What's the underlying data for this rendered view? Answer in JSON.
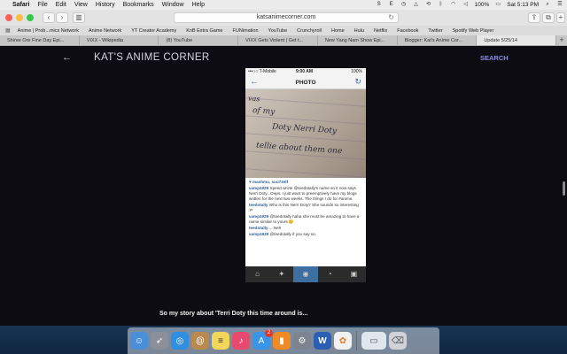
{
  "menubar": {
    "items": [
      "Safari",
      "File",
      "Edit",
      "View",
      "History",
      "Bookmarks",
      "Window",
      "Help"
    ],
    "battery": "100%",
    "clock": "Sat 5:13 PM"
  },
  "toolbar": {
    "url": "katsanimecorner.com"
  },
  "favorites": [
    "Anime | Prob...mics Network",
    "Anime Network",
    "YT Creator Academy",
    "KnB Extra Game",
    "FUNimation",
    "YouTube",
    "Crunchyroll",
    "Home",
    "Hulu",
    "Netflix",
    "Facebook",
    "Twitter",
    "Spotify Web Player"
  ],
  "tabs": [
    {
      "label": "Shiree Ore Fine Day Epi...",
      "active": false
    },
    {
      "label": "VIXX - Wikipedia",
      "active": false
    },
    {
      "label": "(8) YouTube",
      "active": false
    },
    {
      "label": "VIXX Gets Violent | Get t...",
      "active": false
    },
    {
      "label": "New Yang Nam Show Epi...",
      "active": false
    },
    {
      "label": "Blogger: Kat's Anime Cor...",
      "active": false
    },
    {
      "label": "Update 5/25/14",
      "active": true
    }
  ],
  "page": {
    "back_label": "←",
    "site_title": "KAT'S ANIME CORNER",
    "search_label": "SEARCH",
    "caption": "So my story about 'Terri Doty this time around is..."
  },
  "phone": {
    "carrier": "•••○○ T-Mobile",
    "time": "9:00 AM",
    "battery": "100%",
    "title": "PHOTO",
    "handwriting": [
      "vas",
      "of my",
      "Doty Nerri Doty",
      "tellie about them one"
    ],
    "likes": "mashmu, suu73elf",
    "comments": [
      {
        "user": "vamp1929",
        "text": "Speed wrote @teedotally's name so it now says Nerri Doty...Oops. I just want to preemptively have my blogs written for the next two weeks. The things I do for #anime."
      },
      {
        "user": "teedotally",
        "text": "Who is this Nerri Doty? She sounds so interesting :P"
      },
      {
        "user": "vamp1929",
        "text": "@teedotally haha she must be amazing to have a name similar to yours 😊"
      },
      {
        "user": "teedotally",
        "text": "... Neh"
      },
      {
        "user": "vamp1929",
        "text": "@teedotally if you say so."
      }
    ]
  },
  "dock": {
    "apps": [
      {
        "name": "finder-icon",
        "color": "#4a90d9",
        "glyph": "☺"
      },
      {
        "name": "launchpad-icon",
        "color": "#8a8f99",
        "glyph": "🚀"
      },
      {
        "name": "safari-icon",
        "color": "#2f8ee0",
        "glyph": "◎"
      },
      {
        "name": "contacts-icon",
        "color": "#b9894f",
        "glyph": "@"
      },
      {
        "name": "notes-icon",
        "color": "#f2d65a",
        "glyph": "≡"
      },
      {
        "name": "itunes-icon",
        "color": "#e84a6f",
        "glyph": "♪"
      },
      {
        "name": "app-store-icon",
        "color": "#3a95e8",
        "glyph": "A"
      },
      {
        "name": "ibooks-icon",
        "color": "#f08a24",
        "glyph": "▮"
      },
      {
        "name": "system-preferences-icon",
        "color": "#7d8490",
        "glyph": "⚙"
      },
      {
        "name": "word-icon",
        "color": "#2b5fb4",
        "glyph": "W"
      },
      {
        "name": "photos-icon",
        "color": "#f1f1f1",
        "glyph": "✿"
      },
      {
        "name": "preview-icon",
        "color": "#dfe6ee",
        "glyph": "▭"
      },
      {
        "name": "trash-icon",
        "color": "#cfd3d8",
        "glyph": "🗑"
      }
    ],
    "app_store_badge": "2"
  }
}
